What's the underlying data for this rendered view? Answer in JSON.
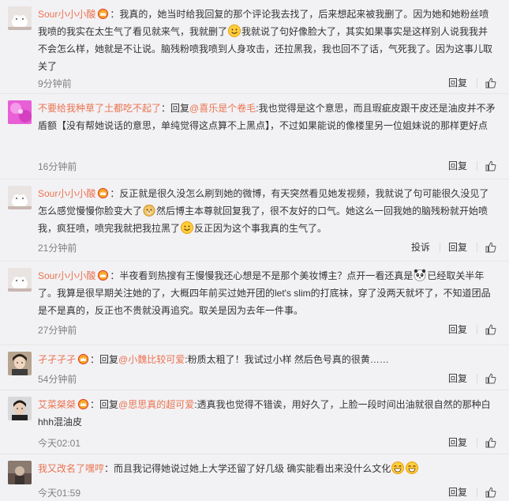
{
  "colors": {
    "username": "#eb7350",
    "background": "#f2f2f5",
    "text": "#333333",
    "meta": "#808080"
  },
  "comments": [
    {
      "user": "Sour小小小酸",
      "badge": "vip-crown-icon",
      "text_parts": [
        "我真的，她当时给我回复的那个评论我去找了，后来想起来被我删了。因为她和她粉丝喷我喷的我实在太生气了看见就来气，我就删了",
        "我就说了句好像脸大了，其实如果事实是这样别人说我我并不会怎么样，她就是不让说。脑残粉喷我喷到人身攻击，还拉黑我，我也回不了话，气死我了。因为这事儿取关了"
      ],
      "emojis": [
        "smile-emoji"
      ],
      "time": "9分钟前",
      "actions": [
        "回复"
      ]
    },
    {
      "user": "不要给我种草了土都吃不起了",
      "badge": "",
      "reply_prefix": "回复",
      "mention": "@喜乐是个卷毛",
      "text_parts": [
        ":我也觉得是这个意思，而且瑕疵皮跟干皮还是油皮并不矛盾额【没有帮她说话的意思，单纯觉得这点算不上黑点】，不过如果能说的像楼里另一位姐妹说的那样更好点"
      ],
      "emojis": [],
      "time": "16分钟前",
      "actions": [
        "回复"
      ]
    },
    {
      "user": "Sour小小小酸",
      "badge": "vip-crown-icon",
      "text_parts": [
        "反正就是很久没怎么刷到她的微博，有天突然看见她发视频，我就说了句可能很久没见了怎么感觉慢慢你脸变大了",
        "然后博主本尊就回复我了，很不友好的口气。她这么一回我她的脑残粉就开始喷我，疯狂喷，喷完我就把我拉黑了",
        "反正因为这个事我真的生气了。"
      ],
      "emojis": [
        "doge-emoji",
        "smile-emoji"
      ],
      "time": "21分钟前",
      "actions": [
        "投诉",
        "回复"
      ]
    },
    {
      "user": "Sour小小小酸",
      "badge": "vip-crown-icon",
      "text_parts": [
        "半夜看到热搜有王慢慢我还心想是不是那个美妆博主？点开一看还真是",
        "已经取关半年了。我算是很早期关注她的了，大概四年前买过她开团的let's slim的打底袜，穿了没两天就坏了，不知道团品是不是真的，反正也不贵就没再追究。取关是因为去年一件事。"
      ],
      "emojis": [
        "panda-emoji"
      ],
      "time": "27分钟前",
      "actions": [
        "回复"
      ]
    },
    {
      "user": "孑孑孑孑",
      "badge": "vip-crown-icon",
      "reply_prefix": "回复",
      "mention": "@小魏比较可爱",
      "text_parts": [
        ":粉质太粗了！我试过小样 然后色号真的很黄……"
      ],
      "emojis": [],
      "time": "54分钟前",
      "actions": [
        "回复"
      ]
    },
    {
      "user": "艾菜桀桀",
      "badge": "vip-crown-icon",
      "reply_prefix": "回复",
      "mention": "@思思真的超可爱",
      "text_parts": [
        ":透真我也觉得不错诶，用好久了，上脸一段时间出油就很自然的那种白hhh混油皮"
      ],
      "emojis": [],
      "time": "今天02:01",
      "actions": [
        "回复"
      ]
    },
    {
      "user": "我又改名了嘿哼",
      "badge": "",
      "text_parts": [
        "而且我记得她说过她上大学还留了好几级 确实能看出来没什么文化"
      ],
      "emojis": [
        "grin-emoji",
        "grin-emoji"
      ],
      "time": "今天01:59",
      "actions": [
        "回复"
      ]
    }
  ]
}
